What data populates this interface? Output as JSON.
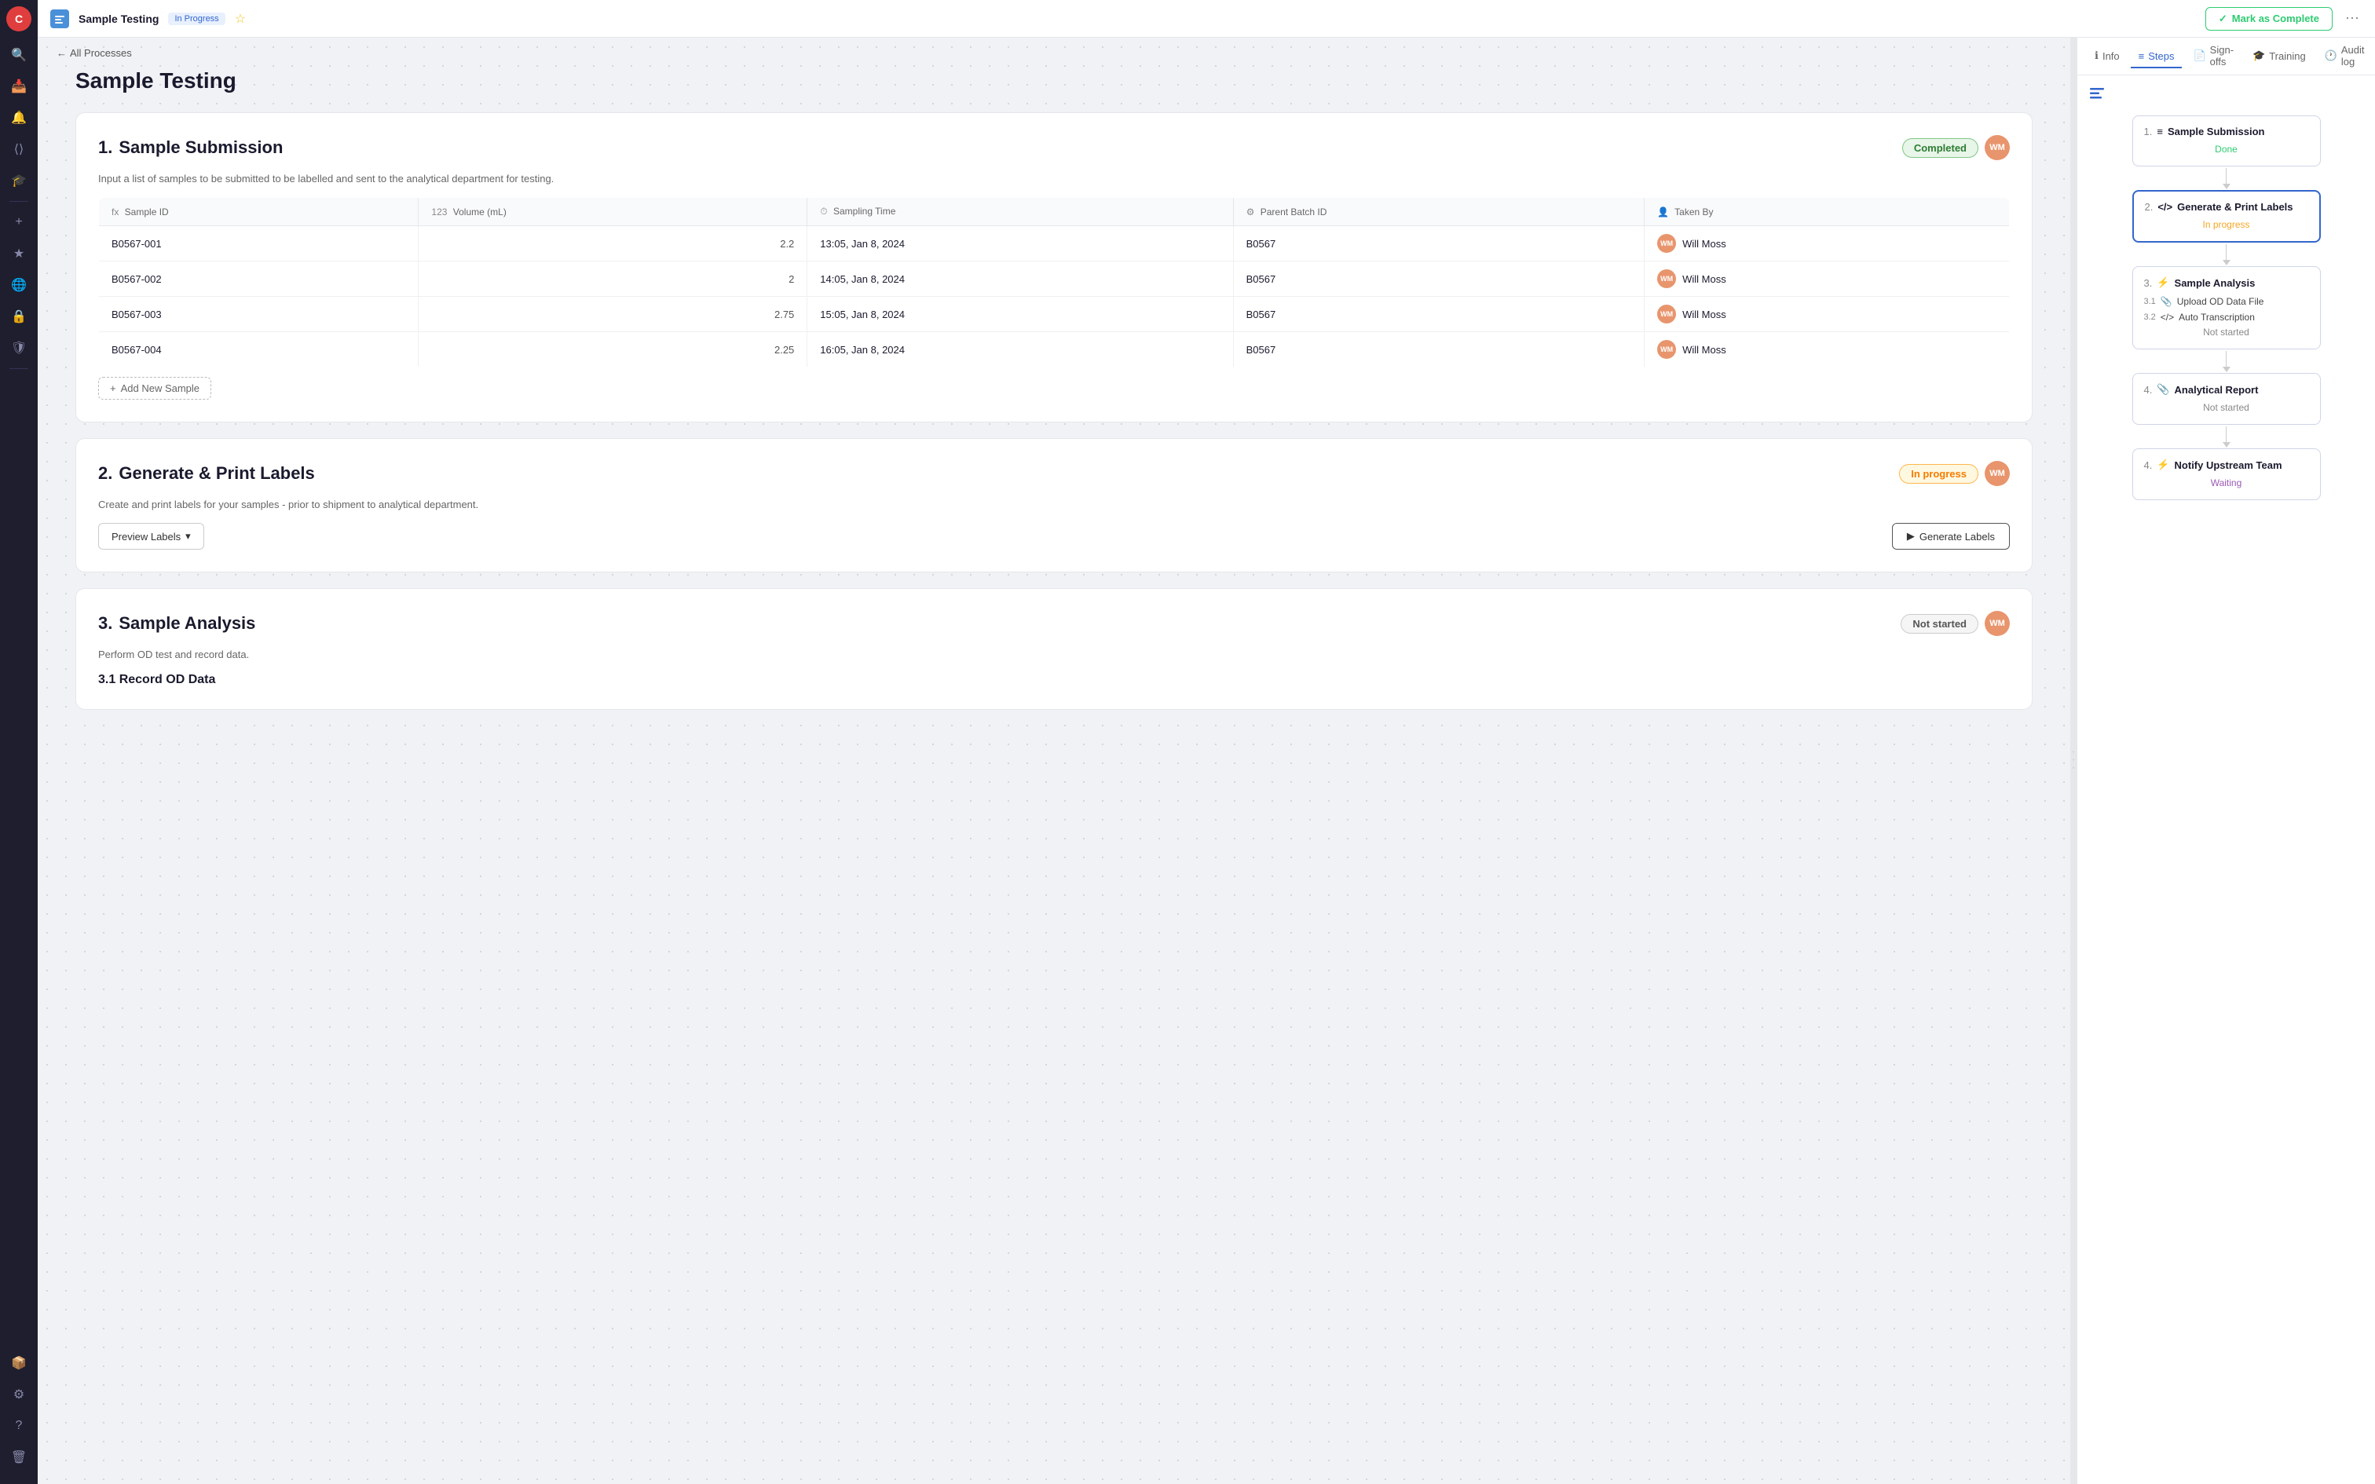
{
  "app": {
    "logo": "C",
    "process_title": "Sample Testing",
    "process_status": "In Progress",
    "breadcrumb_back": "All Processes",
    "mark_complete_label": "Mark as Complete",
    "more_icon": "⋯"
  },
  "sidebar": {
    "items": [
      {
        "id": "search",
        "icon": "🔍"
      },
      {
        "id": "inbox",
        "icon": "📥"
      },
      {
        "id": "bell",
        "icon": "🔔"
      },
      {
        "id": "code",
        "icon": "⟨⟩"
      },
      {
        "id": "cap",
        "icon": "🎓"
      },
      {
        "id": "plus",
        "icon": "+"
      },
      {
        "id": "star",
        "icon": "★"
      },
      {
        "id": "globe",
        "icon": "🌐"
      },
      {
        "id": "lock",
        "icon": "🔒"
      },
      {
        "id": "shield",
        "icon": "🛡"
      }
    ],
    "bottom_items": [
      {
        "id": "box",
        "icon": "📦"
      },
      {
        "id": "gear",
        "icon": "⚙"
      },
      {
        "id": "question",
        "icon": "?"
      },
      {
        "id": "trash",
        "icon": "🗑"
      }
    ]
  },
  "page": {
    "title": "Sample Testing"
  },
  "steps": [
    {
      "number": "1.",
      "title": "Sample Submission",
      "status": "Completed",
      "status_type": "completed",
      "description": "Input a list of samples to be submitted to be labelled and sent to the analytical department for testing.",
      "table": {
        "columns": [
          {
            "icon": "fx",
            "label": "Sample ID"
          },
          {
            "icon": "123",
            "label": "Volume (mL)"
          },
          {
            "icon": "⏱",
            "label": "Sampling Time"
          },
          {
            "icon": "⚙",
            "label": "Parent Batch ID"
          },
          {
            "icon": "👤",
            "label": "Taken By"
          }
        ],
        "rows": [
          {
            "sample_id": "B0567-001",
            "volume": "2.2",
            "sampling_time": "13:05, Jan 8, 2024",
            "batch_id": "B0567",
            "taken_by": "Will Moss"
          },
          {
            "sample_id": "B0567-002",
            "volume": "2",
            "sampling_time": "14:05, Jan 8, 2024",
            "batch_id": "B0567",
            "taken_by": "Will Moss"
          },
          {
            "sample_id": "B0567-003",
            "volume": "2.75",
            "sampling_time": "15:05, Jan 8, 2024",
            "batch_id": "B0567",
            "taken_by": "Will Moss"
          },
          {
            "sample_id": "B0567-004",
            "volume": "2.25",
            "sampling_time": "16:05, Jan 8, 2024",
            "batch_id": "B0567",
            "taken_by": "Will Moss"
          }
        ]
      },
      "add_sample_label": "+ Add New Sample"
    },
    {
      "number": "2.",
      "title": "Generate & Print Labels",
      "status": "In progress",
      "status_type": "inprogress",
      "description": "Create and print labels for your samples - prior to shipment to analytical department.",
      "preview_label": "Preview Labels",
      "generate_label": "▶ Generate Labels"
    },
    {
      "number": "3.",
      "title": "Sample Analysis",
      "status": "Not started",
      "status_type": "notstarted",
      "description": "Perform OD test and record data.",
      "substep_title": "3.1 Record OD Data"
    }
  ],
  "right_panel": {
    "tabs": [
      {
        "id": "info",
        "label": "Info",
        "icon": "ℹ"
      },
      {
        "id": "steps",
        "label": "Steps",
        "icon": "≡",
        "active": true
      },
      {
        "id": "signoffs",
        "label": "Sign-offs",
        "icon": "📄"
      },
      {
        "id": "training",
        "label": "Training",
        "icon": "🎓"
      },
      {
        "id": "auditlog",
        "label": "Audit log",
        "icon": "🕐"
      }
    ],
    "flow_steps": [
      {
        "number": "1.",
        "icon": "≡",
        "title": "Sample Submission",
        "status": "Done",
        "status_type": "done"
      },
      {
        "number": "2.",
        "icon": "</>",
        "title": "Generate & Print Labels",
        "status": "In progress",
        "status_type": "inprogress",
        "active": true
      },
      {
        "number": "3.",
        "icon": "⚡",
        "title": "Sample Analysis",
        "status": "Not started",
        "status_type": "notstarted",
        "substeps": [
          {
            "num": "3.1",
            "icon": "📎",
            "label": "Upload OD Data File"
          },
          {
            "num": "3.2",
            "icon": "</>",
            "label": "Auto Transcription"
          }
        ]
      },
      {
        "number": "4.",
        "icon": "📎",
        "title": "Analytical Report",
        "status": "Not started",
        "status_type": "notstarted"
      },
      {
        "number": "4.",
        "icon": "⚡",
        "title": "Notify Upstream Team",
        "status": "Waiting",
        "status_type": "waiting"
      }
    ]
  }
}
